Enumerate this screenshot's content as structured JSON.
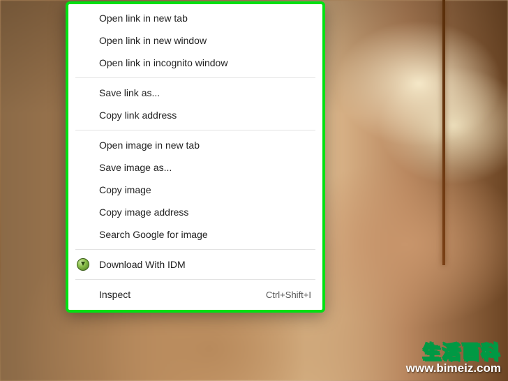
{
  "menu": {
    "groups": [
      [
        {
          "id": "open-link-new-tab",
          "label": "Open link in new tab",
          "icon": null,
          "shortcut": ""
        },
        {
          "id": "open-link-new-window",
          "label": "Open link in new window",
          "icon": null,
          "shortcut": ""
        },
        {
          "id": "open-link-incognito",
          "label": "Open link in incognito window",
          "icon": null,
          "shortcut": ""
        }
      ],
      [
        {
          "id": "save-link-as",
          "label": "Save link as...",
          "icon": null,
          "shortcut": ""
        },
        {
          "id": "copy-link-address",
          "label": "Copy link address",
          "icon": null,
          "shortcut": ""
        }
      ],
      [
        {
          "id": "open-image-new-tab",
          "label": "Open image in new tab",
          "icon": null,
          "shortcut": ""
        },
        {
          "id": "save-image-as",
          "label": "Save image as...",
          "icon": null,
          "shortcut": ""
        },
        {
          "id": "copy-image",
          "label": "Copy image",
          "icon": null,
          "shortcut": ""
        },
        {
          "id": "copy-image-address",
          "label": "Copy image address",
          "icon": null,
          "shortcut": ""
        },
        {
          "id": "search-google-image",
          "label": "Search Google for image",
          "icon": null,
          "shortcut": ""
        }
      ],
      [
        {
          "id": "download-with-idm",
          "label": "Download With IDM",
          "icon": "idm-icon",
          "shortcut": ""
        }
      ],
      [
        {
          "id": "inspect",
          "label": "Inspect",
          "icon": null,
          "shortcut": "Ctrl+Shift+I"
        }
      ]
    ]
  },
  "watermark": {
    "title": "生活百科",
    "url": "www.bimeiz.com"
  },
  "colors": {
    "highlight_border": "#00e013",
    "brand_green": "#009944"
  }
}
